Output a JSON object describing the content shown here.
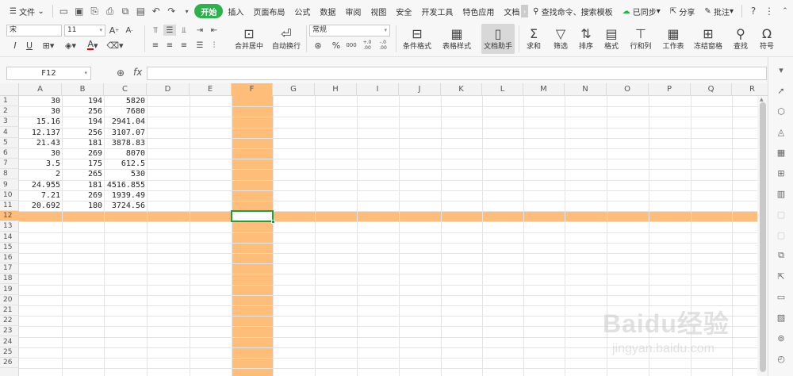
{
  "menubar": {
    "file_label": "文件",
    "tabs": [
      {
        "label": "开始",
        "active": true
      },
      {
        "label": "插入"
      },
      {
        "label": "页面布局"
      },
      {
        "label": "公式"
      },
      {
        "label": "数据"
      },
      {
        "label": "审阅"
      },
      {
        "label": "视图"
      },
      {
        "label": "安全"
      },
      {
        "label": "开发工具"
      },
      {
        "label": "特色应用"
      },
      {
        "label": "文档"
      }
    ],
    "search_placeholder": "查找命令、搜索模板",
    "sync_label": "已同步",
    "share_label": "分享",
    "comment_label": "批注"
  },
  "ribbon": {
    "font_name": "宋",
    "font_size": "11",
    "number_format": "常规",
    "merge_label": "合并居中",
    "wrap_label": "自动换行",
    "cond_format_label": "条件格式",
    "table_style_label": "表格样式",
    "doc_helper_label": "文档助手",
    "sum_label": "求和",
    "filter_label": "筛选",
    "sort_label": "排序",
    "format_label": "格式",
    "rowcol_label": "行和列",
    "sheet_label": "工作表",
    "freeze_label": "冻结窗格",
    "find_label": "查找",
    "symbol_label": "符号",
    "percent": "%",
    "thousands": "000",
    "dec_inc": "+.0\n.00",
    "dec_dec": "-.0\n.00"
  },
  "formula_bar": {
    "cell_ref": "F12",
    "fx_label": "fx",
    "formula": ""
  },
  "sheet": {
    "columns": [
      "A",
      "B",
      "C",
      "D",
      "E",
      "F",
      "G",
      "H",
      "I",
      "J",
      "K",
      "L",
      "M",
      "N",
      "O",
      "P",
      "Q",
      "R"
    ],
    "rows": [
      "1",
      "2",
      "3",
      "4",
      "5",
      "6",
      "7",
      "8",
      "9",
      "10",
      "11",
      "12",
      "13",
      "14",
      "15",
      "16",
      "17",
      "18",
      "19",
      "20",
      "21",
      "22",
      "23",
      "24",
      "25",
      "26"
    ],
    "data": [
      [
        "30",
        "194",
        "5820"
      ],
      [
        "30",
        "256",
        "7680"
      ],
      [
        "15.16",
        "194",
        "2941.04"
      ],
      [
        "12.137",
        "256",
        "3107.07"
      ],
      [
        "21.43",
        "181",
        "3878.83"
      ],
      [
        "30",
        "269",
        "8070"
      ],
      [
        "3.5",
        "175",
        "612.5"
      ],
      [
        "2",
        "265",
        "530"
      ],
      [
        "24.955",
        "181",
        "4516.855"
      ],
      [
        "7.21",
        "269",
        "1939.49"
      ],
      [
        "20.692",
        "180",
        "3724.56"
      ]
    ],
    "highlight_color": "#ffbd7a",
    "selection_color": "#1e9e45"
  },
  "watermark": {
    "line1": "Baidu经验",
    "line2": "jingyan.baidu.com"
  }
}
